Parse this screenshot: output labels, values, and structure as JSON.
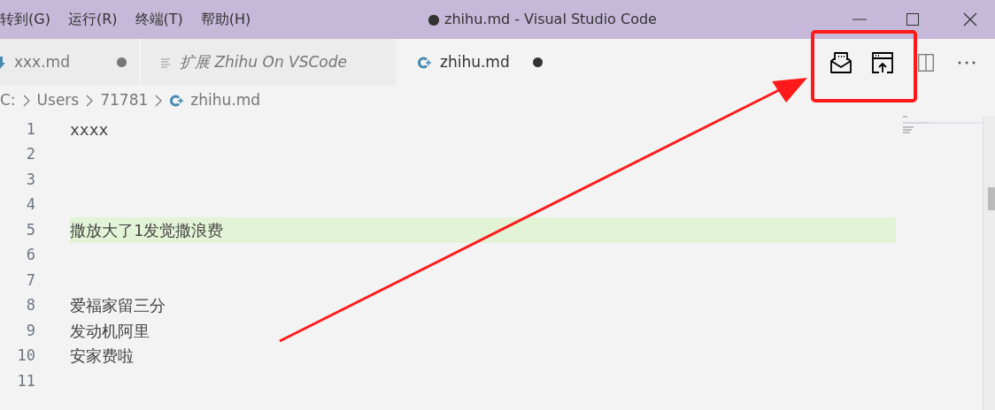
{
  "menu": [
    {
      "label": "转到(G)"
    },
    {
      "label": "运行(R)"
    },
    {
      "label": "终端(T)"
    },
    {
      "label": "帮助(H)"
    }
  ],
  "window": {
    "title": "● zhihu.md - Visual Studio Code"
  },
  "tabs": [
    {
      "kind": "download",
      "label": "xxx.md",
      "selected": false,
      "dirty": true,
      "preview": false
    },
    {
      "kind": "lines",
      "label": "扩展 Zhihu On VSCode",
      "selected": false,
      "dirty": false,
      "preview": true
    },
    {
      "kind": "zhihu",
      "label": "zhihu.md",
      "selected": true,
      "dirty": true,
      "preview": false
    }
  ],
  "breadcrumb": [
    "C:",
    "Users",
    "71781",
    "zhihu.md"
  ],
  "lines": [
    {
      "number": "1",
      "text": "xxxx",
      "highlighted": false
    },
    {
      "number": "2",
      "highlighted": false
    },
    {
      "number": "3",
      "highlighted": false
    },
    {
      "number": "4",
      "highlighted": false
    },
    {
      "number": "5",
      "text": "撒放大了1发觉撒浪费",
      "highlighted": true
    },
    {
      "number": "6",
      "highlighted": false
    },
    {
      "number": "7",
      "highlighted": false
    },
    {
      "number": "8",
      "text": "爱福家留三分",
      "highlighted": false
    },
    {
      "number": "9",
      "text": "发动机阿里",
      "highlighted": false
    },
    {
      "number": "10",
      "text": "安家费啦",
      "highlighted": false
    },
    {
      "number": "11",
      "highlighted": false
    }
  ]
}
